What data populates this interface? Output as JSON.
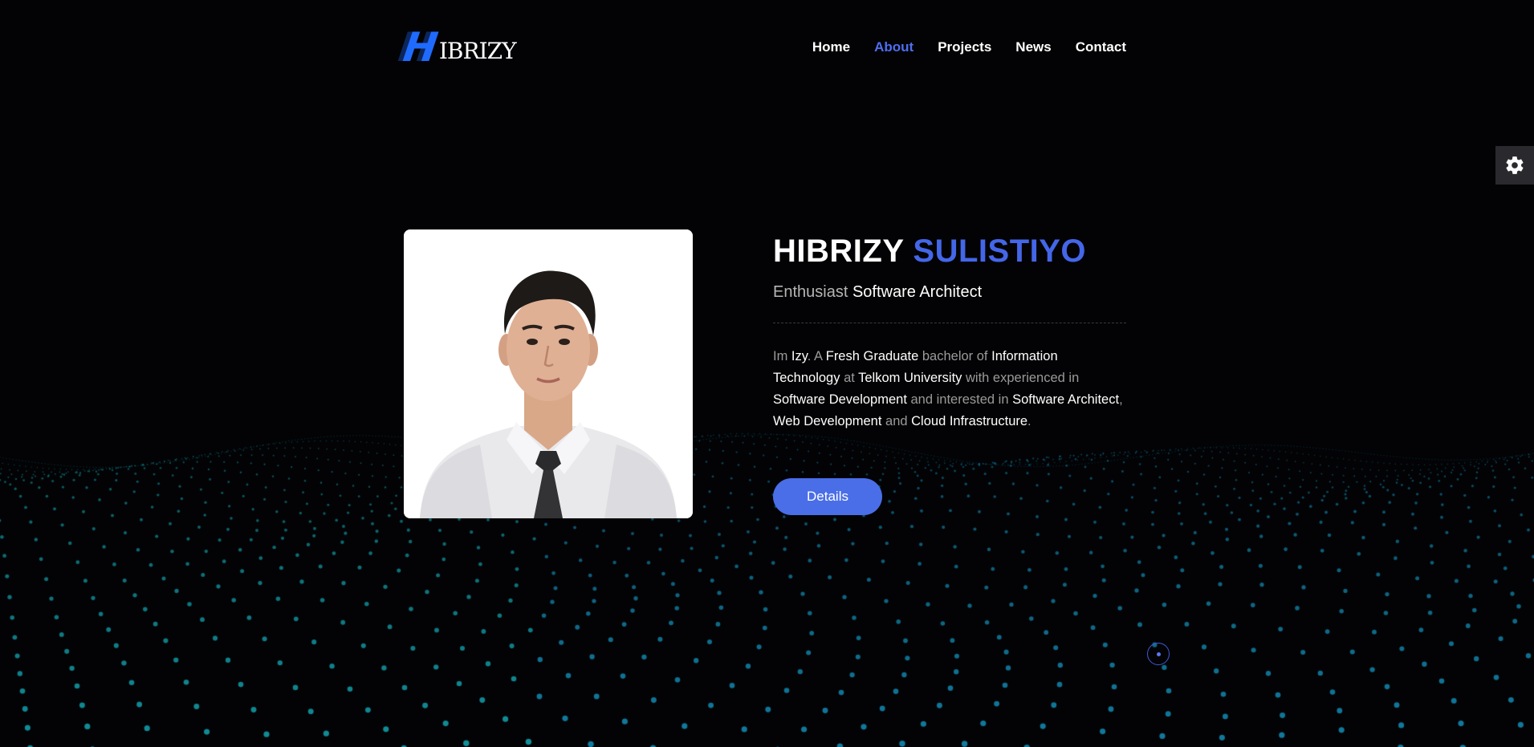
{
  "logo": {
    "mark": "H",
    "text": "IBRIZY"
  },
  "nav": {
    "items": [
      {
        "label": "Home",
        "active": false
      },
      {
        "label": "About",
        "active": true
      },
      {
        "label": "Projects",
        "active": false
      },
      {
        "label": "News",
        "active": false
      },
      {
        "label": "Contact",
        "active": false
      }
    ]
  },
  "settings": {
    "icon": "gear-icon"
  },
  "profile": {
    "first_name": "HIBRIZY",
    "last_name": "SULISTIYO",
    "role_prefix": "Enthusiast",
    "role_main": "Software Architect",
    "bio": [
      {
        "t": "Im ",
        "b": false
      },
      {
        "t": "Izy",
        "b": true
      },
      {
        "t": ". A ",
        "b": false
      },
      {
        "t": "Fresh Graduate",
        "b": true
      },
      {
        "t": " bachelor of ",
        "b": false
      },
      {
        "t": "Information Technology",
        "b": true
      },
      {
        "t": " at ",
        "b": false
      },
      {
        "t": "Telkom University",
        "b": true
      },
      {
        "t": " with experienced in ",
        "b": false
      },
      {
        "t": "Software Development",
        "b": true
      },
      {
        "t": " and interested in ",
        "b": false
      },
      {
        "t": "Software Architect",
        "b": true
      },
      {
        "t": ", ",
        "b": false
      },
      {
        "t": "Web Development",
        "b": true
      },
      {
        "t": " and ",
        "b": false
      },
      {
        "t": "Cloud Infrastructure",
        "b": true
      },
      {
        "t": ".",
        "b": false
      }
    ],
    "details_label": "Details"
  },
  "colors": {
    "accent": "#4466e8",
    "background": "#030305",
    "dots": "#1a9bd0",
    "logo_blue": "#1f6bff"
  }
}
